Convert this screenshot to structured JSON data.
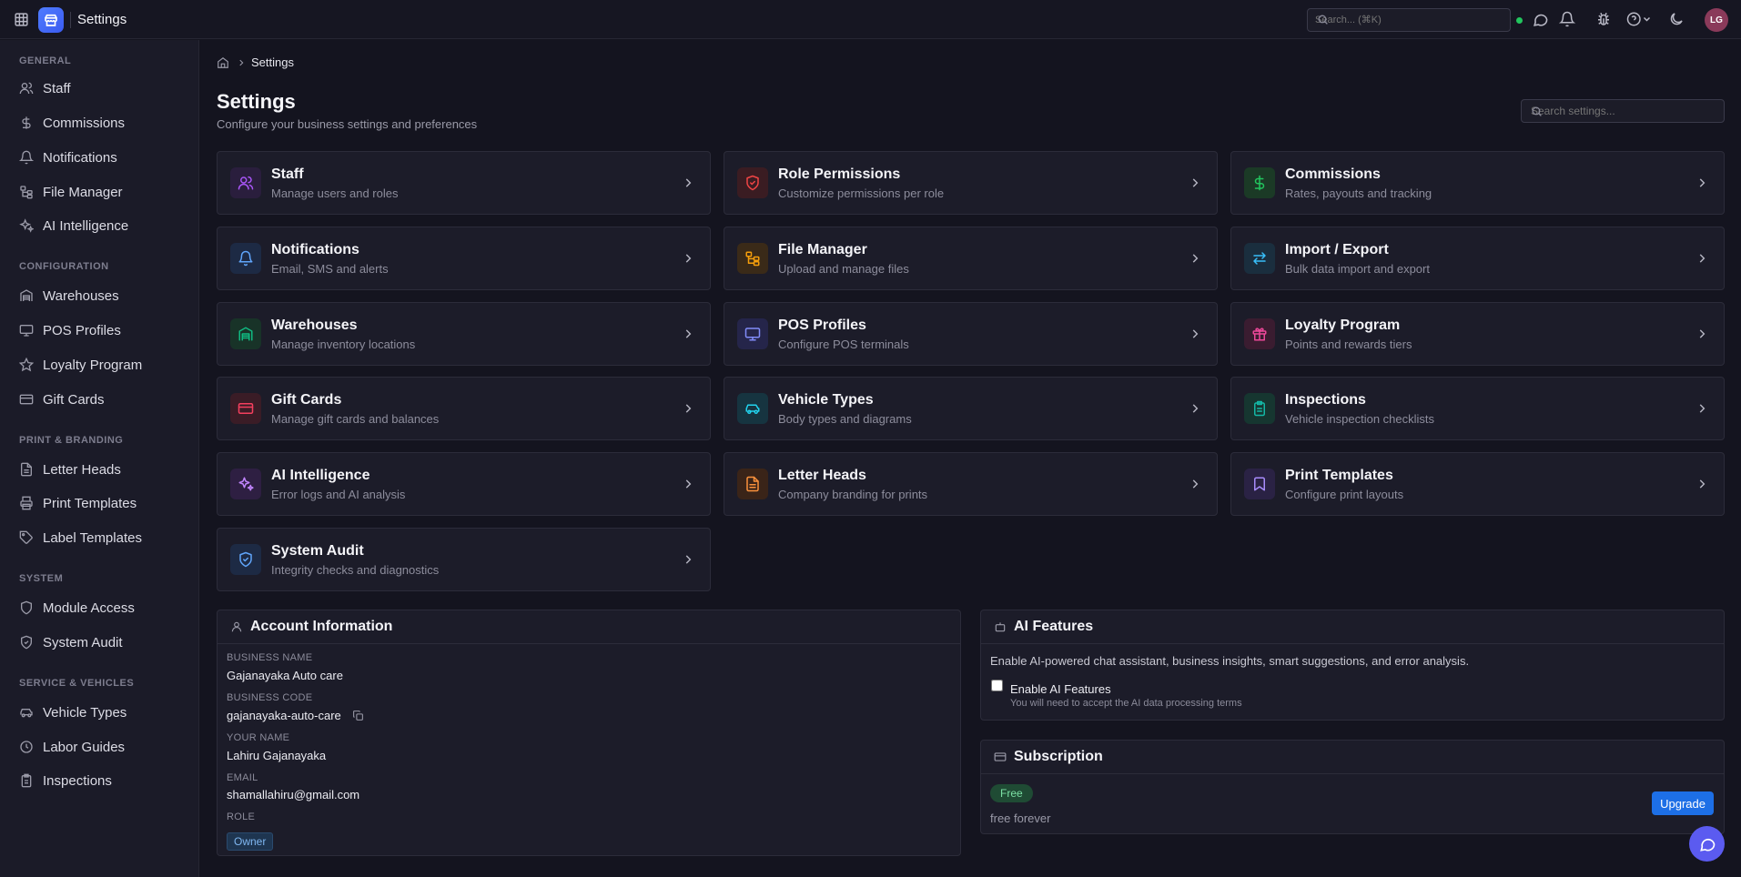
{
  "topbar": {
    "title": "Settings",
    "search_placeholder": "Search... (⌘K)",
    "avatar_initials": "LG"
  },
  "sidebar": {
    "sections": [
      {
        "label": "GENERAL",
        "items": [
          "Staff",
          "Commissions",
          "Notifications",
          "File Manager",
          "AI Intelligence"
        ]
      },
      {
        "label": "CONFIGURATION",
        "items": [
          "Warehouses",
          "POS Profiles",
          "Loyalty Program",
          "Gift Cards"
        ]
      },
      {
        "label": "PRINT & BRANDING",
        "items": [
          "Letter Heads",
          "Print Templates",
          "Label Templates"
        ]
      },
      {
        "label": "SYSTEM",
        "items": [
          "Module Access",
          "System Audit"
        ]
      },
      {
        "label": "SERVICE & VEHICLES",
        "items": [
          "Vehicle Types",
          "Labor Guides",
          "Inspections"
        ]
      }
    ]
  },
  "breadcrumb": {
    "current": "Settings"
  },
  "page": {
    "title": "Settings",
    "subtitle": "Configure your business settings and preferences",
    "search_placeholder": "Search settings..."
  },
  "cards": [
    {
      "title": "Staff",
      "desc": "Manage users and roles",
      "icon": "users-icon",
      "color": "#a855f7",
      "bg": "#2a1e3d"
    },
    {
      "title": "Role Permissions",
      "desc": "Customize permissions per role",
      "icon": "shield-check-icon",
      "color": "#ef4444",
      "bg": "#3a1c22"
    },
    {
      "title": "Commissions",
      "desc": "Rates, payouts and tracking",
      "icon": "dollar-icon",
      "color": "#22c55e",
      "bg": "#1b3a26"
    },
    {
      "title": "Notifications",
      "desc": "Email, SMS and alerts",
      "icon": "bell-icon",
      "color": "#60a5fa",
      "bg": "#1d2a44"
    },
    {
      "title": "File Manager",
      "desc": "Upload and manage files",
      "icon": "folder-tree-icon",
      "color": "#f59e0b",
      "bg": "#3a2a18"
    },
    {
      "title": "Import / Export",
      "desc": "Bulk data import and export",
      "icon": "arrows-icon",
      "color": "#38bdf8",
      "bg": "#1a2e3e"
    },
    {
      "title": "Warehouses",
      "desc": "Manage inventory locations",
      "icon": "warehouse-icon",
      "color": "#10b981",
      "bg": "#183328"
    },
    {
      "title": "POS Profiles",
      "desc": "Configure POS terminals",
      "icon": "monitor-icon",
      "color": "#818cf8",
      "bg": "#25254a"
    },
    {
      "title": "Loyalty Program",
      "desc": "Points and rewards tiers",
      "icon": "gift-icon",
      "color": "#ec4899",
      "bg": "#3a1c30"
    },
    {
      "title": "Gift Cards",
      "desc": "Manage gift cards and balances",
      "icon": "card-icon",
      "color": "#f43f5e",
      "bg": "#3a1c26"
    },
    {
      "title": "Vehicle Types",
      "desc": "Body types and diagrams",
      "icon": "car-icon",
      "color": "#22d3ee",
      "bg": "#163440"
    },
    {
      "title": "Inspections",
      "desc": "Vehicle inspection checklists",
      "icon": "clipboard-icon",
      "color": "#14b8a6",
      "bg": "#163630"
    },
    {
      "title": "AI Intelligence",
      "desc": "Error logs and AI analysis",
      "icon": "sparkles-icon",
      "color": "#c084fc",
      "bg": "#2e1f42"
    },
    {
      "title": "Letter Heads",
      "desc": "Company branding for prints",
      "icon": "document-icon",
      "color": "#fb923c",
      "bg": "#3a2418"
    },
    {
      "title": "Print Templates",
      "desc": "Configure print layouts",
      "icon": "bookmark-icon",
      "color": "#a78bfa",
      "bg": "#2a2244"
    },
    {
      "title": "System Audit",
      "desc": "Integrity checks and diagnostics",
      "icon": "shield-check-icon",
      "color": "#60a5fa",
      "bg": "#1d2a44"
    }
  ],
  "account": {
    "title": "Account Information",
    "business_name_label": "BUSINESS NAME",
    "business_name": "Gajanayaka Auto care",
    "business_code_label": "BUSINESS CODE",
    "business_code": "gajanayaka-auto-care",
    "your_name_label": "YOUR NAME",
    "your_name": "Lahiru Gajanayaka",
    "email_label": "EMAIL",
    "email": "shamallahiru@gmail.com",
    "role_label": "ROLE",
    "role": "Owner"
  },
  "ai_features": {
    "title": "AI Features",
    "description": "Enable AI-powered chat assistant, business insights, smart suggestions, and error analysis.",
    "checkbox_label": "Enable AI Features",
    "checkbox_hint": "You will need to accept the AI data processing terms",
    "enabled": false
  },
  "subscription": {
    "title": "Subscription",
    "plan": "Free",
    "plan_text": "free forever",
    "upgrade_label": "Upgrade"
  }
}
